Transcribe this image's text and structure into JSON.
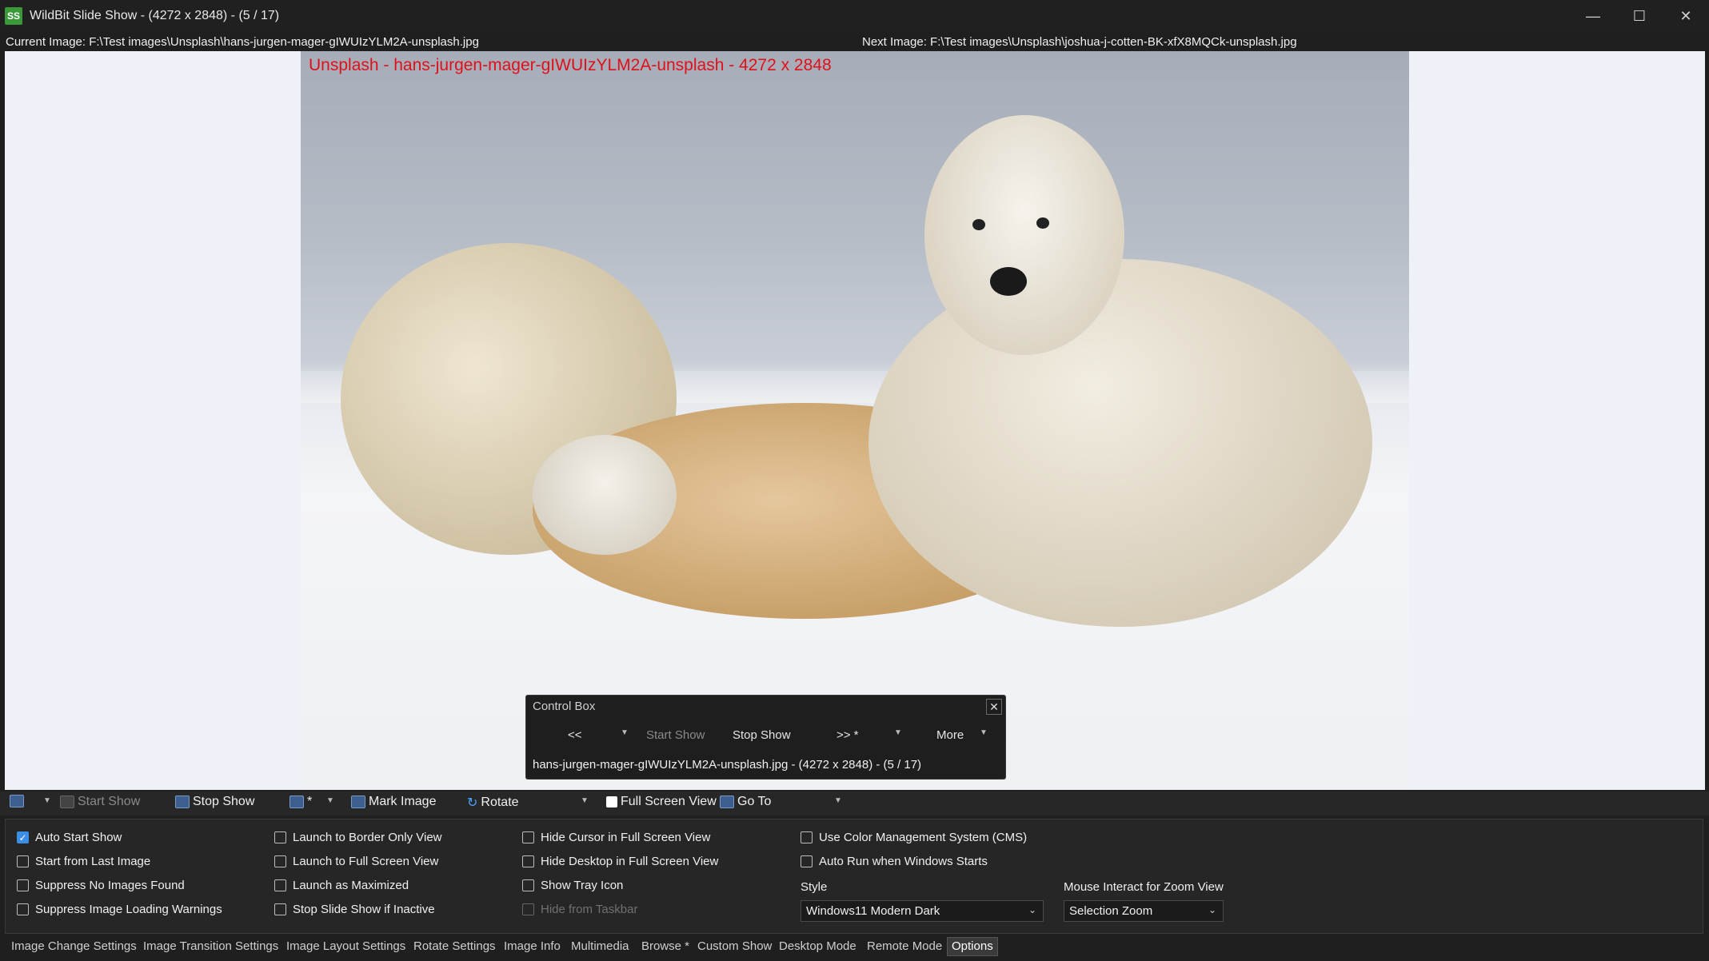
{
  "window": {
    "app_icon_text": "SS",
    "title": "WildBit Slide Show - (4272 x 2848) - (5 / 17)",
    "minimize": "—",
    "maximize": "☐",
    "close": "✕"
  },
  "infobar": {
    "current": "Current Image: F:\\Test images\\Unsplash\\hans-jurgen-mager-gIWUIzYLM2A-unsplash.jpg",
    "next": "Next Image: F:\\Test images\\Unsplash\\joshua-j-cotten-BK-xfX8MQCk-unsplash.jpg"
  },
  "viewer": {
    "caption": "Unsplash - hans-jurgen-mager-gIWUIzYLM2A-unsplash - 4272 x 2848"
  },
  "control_box": {
    "title": "Control Box",
    "prev": "<<",
    "start_show": "Start Show",
    "stop_show": "Stop Show",
    "next": ">> *",
    "more": "More",
    "close": "✕",
    "status": "hans-jurgen-mager-gIWUIzYLM2A-unsplash.jpg - (4272 x 2848) - (5 / 17)"
  },
  "toolbar": {
    "start_show": "Start Show",
    "stop_show": "Stop Show",
    "next_star": "*",
    "mark_image": "Mark Image",
    "rotate": "Rotate",
    "full_screen": "Full Screen View",
    "go_to": "Go To"
  },
  "options": {
    "col1": [
      {
        "label": "Auto Start Show",
        "checked": true
      },
      {
        "label": "Start from Last Image",
        "checked": false
      },
      {
        "label": "Suppress No Images Found",
        "checked": false
      },
      {
        "label": "Suppress Image Loading Warnings",
        "checked": false
      }
    ],
    "col2": [
      {
        "label": "Launch to Border Only View",
        "checked": false
      },
      {
        "label": "Launch to Full Screen View",
        "checked": false
      },
      {
        "label": "Launch as Maximized",
        "checked": false
      },
      {
        "label": "Stop Slide Show if Inactive",
        "checked": false
      }
    ],
    "col3": [
      {
        "label": "Hide Cursor in Full Screen View",
        "checked": false
      },
      {
        "label": "Hide Desktop in Full Screen View",
        "checked": false
      },
      {
        "label": "Show Tray Icon",
        "checked": false
      },
      {
        "label": "Hide from Taskbar",
        "checked": false,
        "disabled": true
      }
    ],
    "col4": [
      {
        "label": "Use Color Management System (CMS)",
        "checked": false
      },
      {
        "label": "Auto Run when Windows Starts",
        "checked": false
      }
    ],
    "style_label": "Style",
    "style_value": "Windows11 Modern Dark",
    "zoom_label": "Mouse Interact for Zoom View",
    "zoom_value": "Selection Zoom",
    "checkmark": "✓"
  },
  "tabs": [
    "Image Change Settings",
    "Image Transition Settings",
    "Image Layout Settings",
    "Rotate Settings",
    "Image Info",
    "Multimedia",
    "Browse *",
    "Custom Show",
    "Desktop Mode",
    "Remote Mode",
    "Options"
  ],
  "colors": {
    "accent": "#3a8ee6",
    "caption": "#e0101a",
    "background": "#1f1f1f"
  }
}
